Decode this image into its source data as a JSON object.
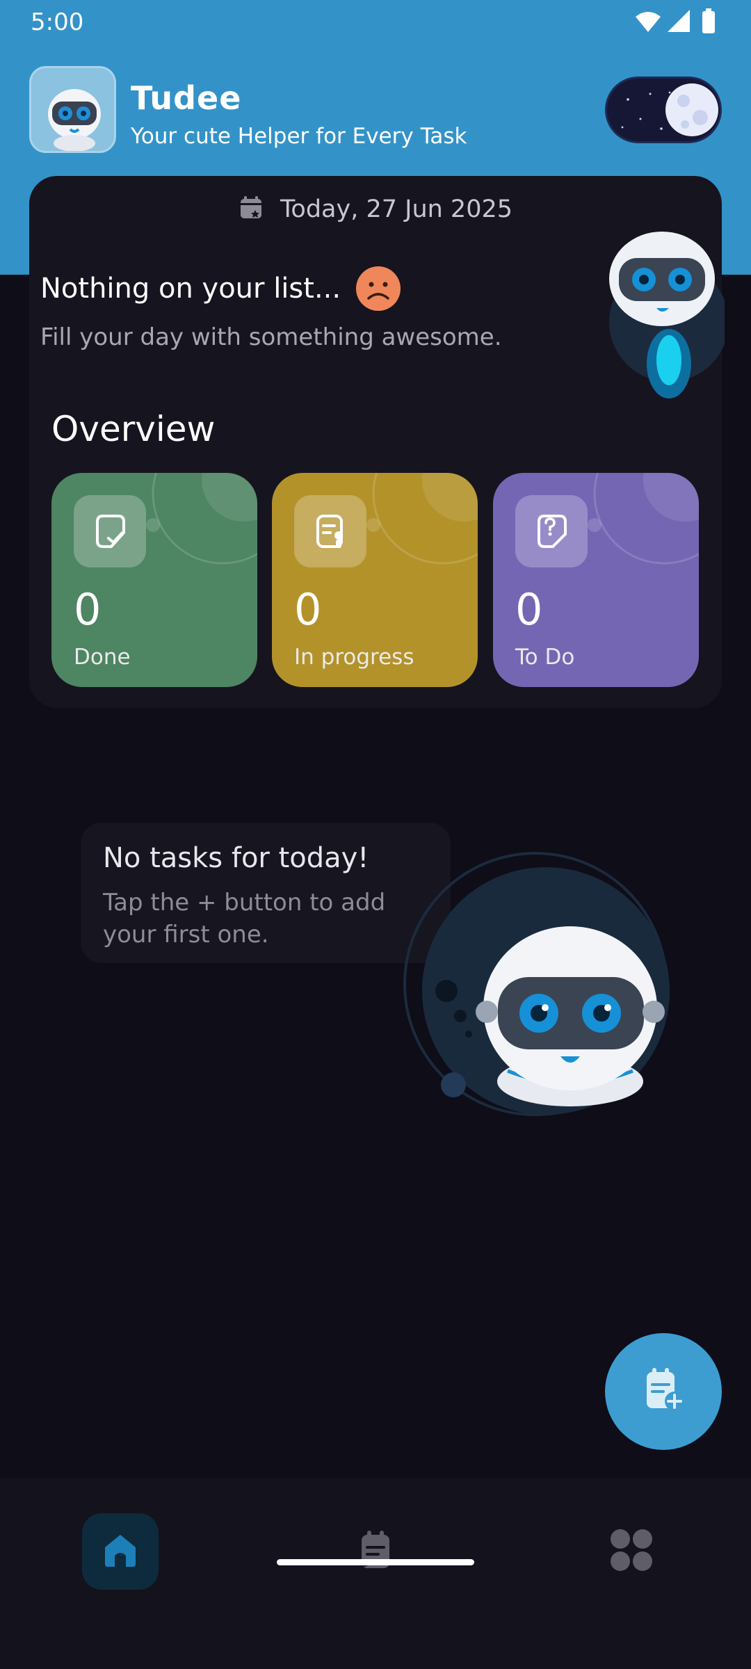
{
  "status_bar": {
    "time": "5:00",
    "icons": [
      "wifi-icon",
      "signal-icon",
      "battery-icon"
    ]
  },
  "header": {
    "title": "Tudee",
    "subtitle": "Your cute Helper for Every Task",
    "logo_icon": "robot-logo-icon",
    "theme_toggle_state": "dark"
  },
  "summary_card": {
    "date": "Today, 27 Jun 2025",
    "empty_title": "Nothing on your list...",
    "empty_subtitle": "Fill your day with something awesome.",
    "overview_title": "Overview",
    "stats": [
      {
        "count": "0",
        "label": "Done",
        "color": "#4e8563",
        "icon": "done-task-icon"
      },
      {
        "count": "0",
        "label": "In progress",
        "color": "#b3922a",
        "icon": "in-progress-task-icon"
      },
      {
        "count": "0",
        "label": "To Do",
        "color": "#7566b4",
        "icon": "todo-task-icon"
      }
    ]
  },
  "empty_state": {
    "title": "No tasks for today!",
    "subtitle": "Tap the + button to add your first one."
  },
  "fab": {
    "icon": "add-task-icon",
    "color": "#3d9dd1"
  },
  "bottom_nav": {
    "items": [
      {
        "name": "home",
        "icon": "home-icon",
        "active": true
      },
      {
        "name": "tasks",
        "icon": "tasks-icon",
        "active": false
      },
      {
        "name": "categories",
        "icon": "categories-icon",
        "active": false
      }
    ]
  },
  "colors": {
    "brand": "#3393c8",
    "background": "#0e0d18",
    "card": "#16141f"
  }
}
